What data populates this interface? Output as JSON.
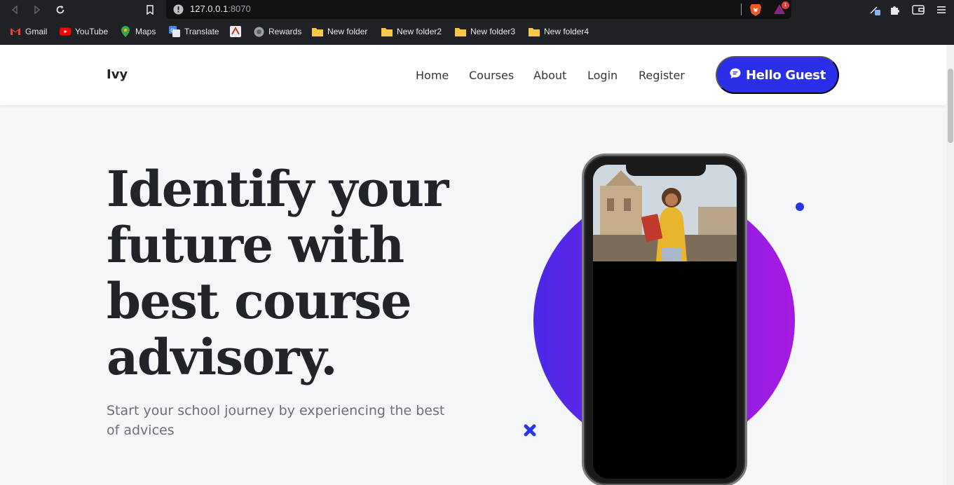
{
  "browser": {
    "url_host": "127.0.0.1",
    "url_port": ":8070",
    "notification_count": "1",
    "bookmarks": [
      {
        "label": "Gmail",
        "icon": "gmail-icon"
      },
      {
        "label": "YouTube",
        "icon": "youtube-icon"
      },
      {
        "label": "Maps",
        "icon": "maps-icon"
      },
      {
        "label": "Translate",
        "icon": "translate-icon"
      },
      {
        "label": "",
        "icon": "bookmark-site-icon"
      },
      {
        "label": "Rewards",
        "icon": "rewards-icon"
      },
      {
        "label": "New folder",
        "icon": "folder-icon"
      },
      {
        "label": "New folder2",
        "icon": "folder-icon"
      },
      {
        "label": "New folder3",
        "icon": "folder-icon"
      },
      {
        "label": "New folder4",
        "icon": "folder-icon"
      }
    ]
  },
  "nav": {
    "brand": "Ivy",
    "links": [
      "Home",
      "Courses",
      "About",
      "Login",
      "Register"
    ],
    "cta": "Hello Guest",
    "cta_icon": "chat-icon"
  },
  "hero": {
    "title_lines": [
      "Identify your",
      "future with",
      "best course",
      "advisory."
    ],
    "subtitle": "Start your school journey by experiencing the best of advices"
  },
  "colors": {
    "accent": "#2b2fe8",
    "gradient_start": "#4a29e6",
    "gradient_end": "#a51ae0",
    "title": "#212529",
    "subtitle": "#6b7079"
  }
}
